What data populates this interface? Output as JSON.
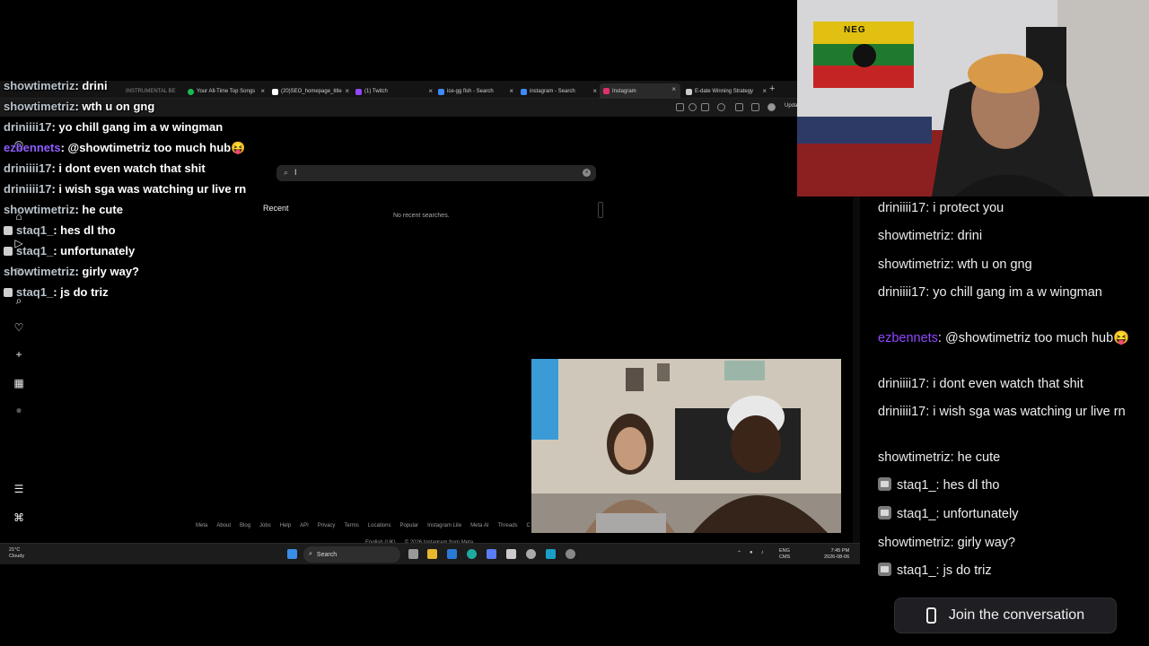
{
  "colors": {
    "chat_username_white": "#e8e8e8",
    "chat_username_purple": "#9147ff",
    "chat_username_green": "#7db88a",
    "overlay_username_gray": "#b9c2c9",
    "overlay_username_purple": "#8f5cff",
    "taskbar": "#1c1c1c",
    "page_bg": "#000000"
  },
  "browser": {
    "tabs": [
      {
        "label": "INSTRUMENTAL BE",
        "icon": "music-icon",
        "color": "#ff3d3d"
      },
      {
        "label": "Your All-Time Top Songs",
        "icon": "spotify-icon",
        "color": "#1db954"
      },
      {
        "label": "(20)SEO_homepage_title",
        "icon": "tiktok-icon",
        "color": "#ffffff"
      },
      {
        "label": "(1) Twitch",
        "icon": "twitch-icon",
        "color": "#9147ff"
      },
      {
        "label": "ice-gg fish - Search",
        "icon": "search-icon",
        "color": "#3d8bff"
      },
      {
        "label": "instagram - Search",
        "icon": "search-icon",
        "color": "#3d8bff"
      },
      {
        "label": "Instagram",
        "icon": "instagram-icon",
        "color": "#e1306c"
      },
      {
        "label": "E-date Winning Strategy",
        "icon": "page-icon",
        "color": "#cccccc"
      }
    ],
    "update_label": "Upda"
  },
  "instagram": {
    "search_value": "I",
    "recent_label": "Recent",
    "no_recent_label": "No recent searches.",
    "footer_links": [
      "Meta",
      "About",
      "Blog",
      "Jobs",
      "Help",
      "API",
      "Privacy",
      "Terms",
      "Locations",
      "Popular",
      "Instagram Lite",
      "Meta AI",
      "Threads",
      "C"
    ],
    "language": "English (UK)",
    "copyright": "© 2026 Instagram from Meta"
  },
  "overlay_chat": [
    {
      "user": "showtimetriz",
      "text": "drini",
      "color": "gray",
      "badge": false
    },
    {
      "user": "showtimetriz",
      "text": "wth u on gng",
      "color": "gray",
      "badge": false
    },
    {
      "user": "driniiii17",
      "text": "yo chill gang im a w wingman",
      "color": "gray",
      "badge": false
    },
    {
      "user": "ezbennets",
      "text": "@showtimetriz too much hub😝",
      "color": "purple",
      "badge": false
    },
    {
      "user": "driniiii17",
      "text": "i dont even watch that shit",
      "color": "gray",
      "badge": false
    },
    {
      "user": "driniiii17",
      "text": "i wish sga was watching ur live rn",
      "color": "gray",
      "badge": false
    },
    {
      "user": "showtimetriz",
      "text": "he cute",
      "color": "gray",
      "badge": false
    },
    {
      "user": "staq1_",
      "text": "hes dl tho",
      "color": "gray",
      "badge": true
    },
    {
      "user": "staq1_",
      "text": "unfortunately",
      "color": "gray",
      "badge": true
    },
    {
      "user": "showtimetriz",
      "text": "girly way?",
      "color": "gray",
      "badge": false
    },
    {
      "user": "staq1_",
      "text": "js do triz",
      "color": "gray",
      "badge": true
    }
  ],
  "taskbar": {
    "weather_temp": "21°C",
    "weather_desc": "Cloudy",
    "search_label": "Search",
    "lang_top": "ENG",
    "lang_bottom": "CMS",
    "time": "7:45 PM",
    "date": "2026-08-06"
  },
  "chat": {
    "messages": [
      {
        "user": "driniiii17",
        "text": "i protect you",
        "color": "white",
        "badge": false
      },
      {
        "user": "showtimetriz",
        "text": "drini",
        "color": "white",
        "badge": false
      },
      {
        "user": "showtimetriz",
        "text": "wth u on gng",
        "color": "white",
        "badge": false
      },
      {
        "user": "driniiii17",
        "text": "yo chill gang im a w wingman",
        "color": "white",
        "badge": false
      },
      {
        "user": "ezbennets",
        "text": "@showtimetriz too much hub😝",
        "color": "purple",
        "badge": false
      },
      {
        "user": "driniiii17",
        "text": "i dont even watch that shit",
        "color": "white",
        "badge": false
      },
      {
        "user": "driniiii17",
        "text": "i wish sga was watching ur live rn",
        "color": "white",
        "badge": false
      },
      {
        "user": "showtimetriz",
        "text": "he cute",
        "color": "white",
        "badge": false
      },
      {
        "user": "staq1_",
        "text": "hes dl tho",
        "color": "white",
        "badge": true
      },
      {
        "user": "staq1_",
        "text": "unfortunately",
        "color": "white",
        "badge": true
      },
      {
        "user": "showtimetriz",
        "text": "girly way?",
        "color": "white",
        "badge": false
      },
      {
        "user": "staq1_",
        "text": "js do triz",
        "color": "white",
        "badge": true
      }
    ],
    "join_label": "Join the conversation",
    "join_icon": "phone-icon"
  },
  "webcam_main": {
    "flag_text": "NEG"
  }
}
